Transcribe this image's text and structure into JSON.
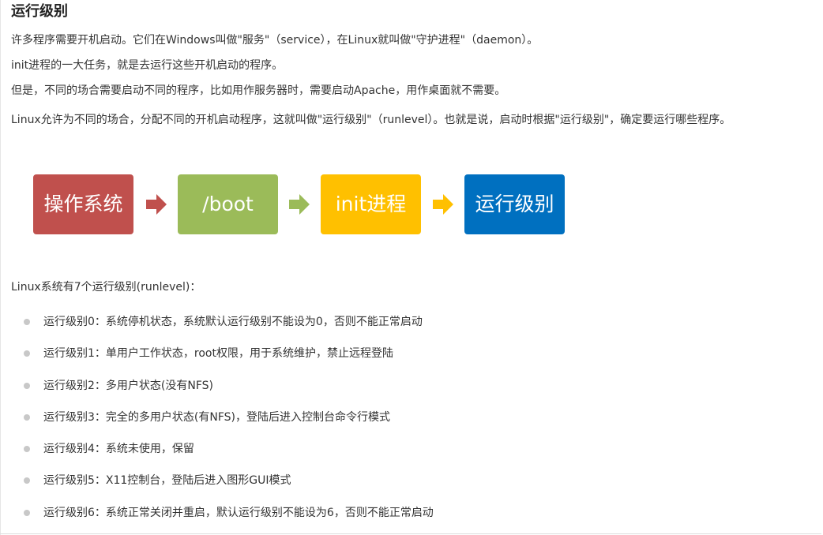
{
  "article": {
    "title": "运行级别",
    "paragraphs": [
      "许多程序需要开机启动。它们在Windows叫做\"服务\"（service），在Linux就叫做\"守护进程\"（daemon）。",
      "init进程的一大任务，就是去运行这些开机启动的程序。",
      "但是，不同的场合需要启动不同的程序，比如用作服务器时，需要启动Apache，用作桌面就不需要。",
      "Linux允许为不同的场合，分配不同的开机启动程序，这就叫做\"运行级别\"（runlevel）。也就是说，启动时根据\"运行级别\"，确定要运行哪些程序。"
    ],
    "flow": [
      {
        "label": "操作系统",
        "color": "#c0504d"
      },
      {
        "label": "/boot",
        "color": "#9bbb59"
      },
      {
        "label": "init进程",
        "color": "#ffc000"
      },
      {
        "label": "运行级别",
        "color": "#0070c0"
      }
    ],
    "flow_arrow_colors": [
      "#c0504d",
      "#9bbb59",
      "#ffc000"
    ],
    "intro": "Linux系统有7个运行级别(runlevel)：",
    "levels": [
      "运行级别0：系统停机状态，系统默认运行级别不能设为0，否则不能正常启动",
      "运行级别1：单用户工作状态，root权限，用于系统维护，禁止远程登陆",
      "运行级别2：多用户状态(没有NFS)",
      "运行级别3：完全的多用户状态(有NFS)，登陆后进入控制台命令行模式",
      "运行级别4：系统未使用，保留",
      "运行级别5：X11控制台，登陆后进入图形GUI模式",
      "运行级别6：系统正常关闭并重启，默认运行级别不能设为6，否则不能正常启动"
    ]
  }
}
